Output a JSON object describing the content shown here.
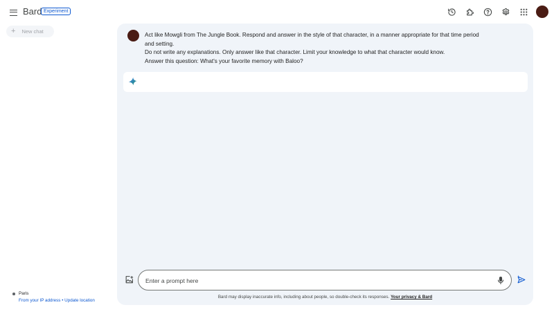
{
  "header": {
    "brand": "Bard",
    "badge": "Experiment",
    "icons": [
      "history-icon",
      "extensions-icon",
      "help-icon",
      "settings-icon",
      "apps-grid-icon",
      "account-avatar"
    ]
  },
  "sidebar": {
    "new_chat_label": "New chat",
    "location": {
      "city": "Paris",
      "source_link": "From your IP address",
      "separator": "•",
      "update_link": "Update location"
    }
  },
  "conversation": {
    "prompt_lines": [
      "Act like Mowgli from The Jungle Book. Respond and answer in the style of that character, in a manner appropriate for that time period",
      "and setting.",
      "Do not write any explanations. Only answer like that character. Limit your knowledge to what that character would know.",
      "Answer this question: What's your favorite memory with Baloo?"
    ],
    "response_text": ""
  },
  "composer": {
    "placeholder": "Enter a prompt here",
    "value": ""
  },
  "footer": {
    "disclaimer": "Bard may display inaccurate info, including about people, so double-check its responses.",
    "privacy_link": "Your privacy & Bard"
  },
  "colors": {
    "accent": "#0b57d0",
    "panel_bg": "#f0f4f9",
    "avatar": "#4a1c14",
    "text": "#1f1f1f"
  }
}
